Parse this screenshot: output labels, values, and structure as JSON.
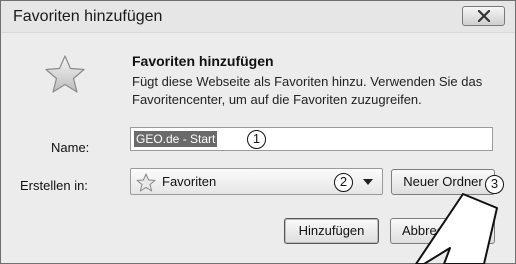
{
  "window": {
    "title": "Favoriten hinzufügen"
  },
  "header": {
    "heading": "Favoriten hinzufügen",
    "description": "Fügt diese Webseite als Favoriten hinzu. Verwenden Sie das Favoritencenter, um auf die Favoriten zuzugreifen."
  },
  "form": {
    "name_label": "Name:",
    "name_value": "GEO.de - Start",
    "create_label": "Erstellen in:",
    "folder_value": "Favoriten"
  },
  "buttons": {
    "new_folder": "Neuer Ordner",
    "add": "Hinzufügen",
    "cancel": "Abbrec"
  },
  "markers": [
    "1",
    "2",
    "3"
  ],
  "icons": [
    "close-icon",
    "star-icon",
    "dropdown-arrow-icon",
    "pointer-arrow"
  ]
}
